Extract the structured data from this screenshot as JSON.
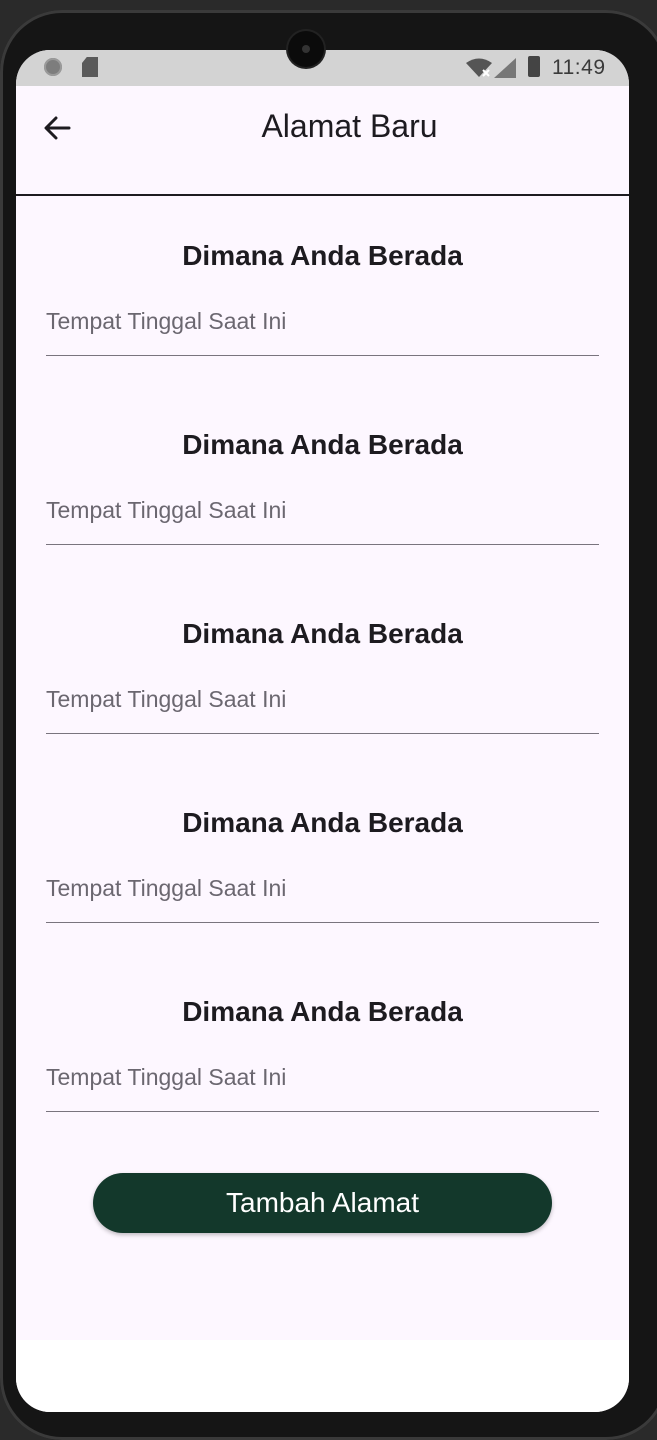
{
  "status_bar": {
    "time": "11:49"
  },
  "app_bar": {
    "title": "Alamat Baru",
    "back_icon": "arrow-left-icon"
  },
  "sections": [
    {
      "title": "Dimana Anda Berada",
      "placeholder": "Tempat Tinggal Saat Ini",
      "value": ""
    },
    {
      "title": "Dimana Anda Berada",
      "placeholder": "Tempat Tinggal Saat Ini",
      "value": ""
    },
    {
      "title": "Dimana Anda Berada",
      "placeholder": "Tempat Tinggal Saat Ini",
      "value": ""
    },
    {
      "title": "Dimana Anda Berada",
      "placeholder": "Tempat Tinggal Saat Ini",
      "value": ""
    },
    {
      "title": "Dimana Anda Berada",
      "placeholder": "Tempat Tinggal Saat Ini",
      "value": ""
    }
  ],
  "actions": {
    "add_address_label": "Tambah Alamat"
  },
  "colors": {
    "background": "#fdf7ff",
    "button": "#13382b",
    "text": "#1d1b20"
  }
}
